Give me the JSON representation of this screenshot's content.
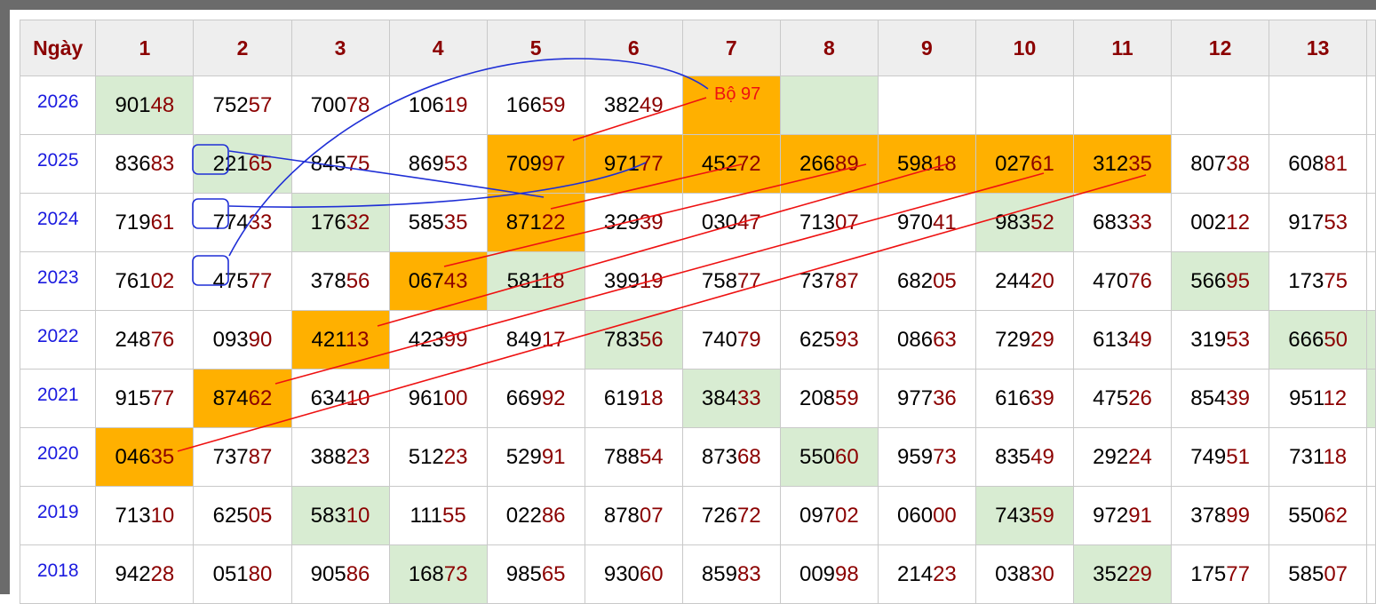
{
  "headers": [
    "Ngày",
    "1",
    "2",
    "3",
    "4",
    "5",
    "6",
    "7",
    "8",
    "9",
    "10",
    "11",
    "12",
    "13"
  ],
  "annotation": "Bộ 97",
  "colors": {
    "year_text": "#1a1adf",
    "header_text": "#8b0000",
    "digit_highlight": "#8b0000",
    "green_cell": "#d8ecd2",
    "orange_cell": "#ffb000",
    "line_red": "#ee1111",
    "line_blue": "#1f2fd6"
  },
  "rows": [
    {
      "year": "2026",
      "cells": [
        {
          "v": "90148",
          "bg": "green"
        },
        {
          "v": "75257"
        },
        {
          "v": "70078"
        },
        {
          "v": "10619"
        },
        {
          "v": "16659"
        },
        {
          "v": "38249"
        },
        {
          "v": "",
          "bg": "orange"
        },
        {
          "v": "",
          "bg": "green"
        },
        {
          "v": ""
        },
        {
          "v": ""
        },
        {
          "v": ""
        },
        {
          "v": ""
        },
        {
          "v": ""
        }
      ]
    },
    {
      "year": "2025",
      "cells": [
        {
          "v": "83683"
        },
        {
          "v": "22165",
          "bg": "green"
        },
        {
          "v": "84575"
        },
        {
          "v": "86953"
        },
        {
          "v": "70997",
          "bg": "orange"
        },
        {
          "v": "97177",
          "bg": "orange"
        },
        {
          "v": "45272",
          "bg": "orange"
        },
        {
          "v": "26689",
          "bg": "orange"
        },
        {
          "v": "59818",
          "bg": "orange"
        },
        {
          "v": "02761",
          "bg": "orange"
        },
        {
          "v": "31235",
          "bg": "orange"
        },
        {
          "v": "80738"
        },
        {
          "v": "60881"
        }
      ]
    },
    {
      "year": "2024",
      "cells": [
        {
          "v": "71961"
        },
        {
          "v": "77433"
        },
        {
          "v": "17632",
          "bg": "green"
        },
        {
          "v": "58535"
        },
        {
          "v": "87122",
          "bg": "orange"
        },
        {
          "v": "32939"
        },
        {
          "v": "03047"
        },
        {
          "v": "71307"
        },
        {
          "v": "97041"
        },
        {
          "v": "98352",
          "bg": "green"
        },
        {
          "v": "68333"
        },
        {
          "v": "00212"
        },
        {
          "v": "91753"
        }
      ]
    },
    {
      "year": "2023",
      "cells": [
        {
          "v": "76102"
        },
        {
          "v": "47577"
        },
        {
          "v": "37856"
        },
        {
          "v": "06743",
          "bg": "orange"
        },
        {
          "v": "58118",
          "bg": "green"
        },
        {
          "v": "39919"
        },
        {
          "v": "75877"
        },
        {
          "v": "73787"
        },
        {
          "v": "68205"
        },
        {
          "v": "24420"
        },
        {
          "v": "47076"
        },
        {
          "v": "56695",
          "bg": "green"
        },
        {
          "v": "17375"
        }
      ]
    },
    {
      "year": "2022",
      "cells": [
        {
          "v": "24876"
        },
        {
          "v": "09390"
        },
        {
          "v": "42113",
          "bg": "orange"
        },
        {
          "v": "42399"
        },
        {
          "v": "84917"
        },
        {
          "v": "78356",
          "bg": "green"
        },
        {
          "v": "74079"
        },
        {
          "v": "62593"
        },
        {
          "v": "08663"
        },
        {
          "v": "72929"
        },
        {
          "v": "61349"
        },
        {
          "v": "31953"
        },
        {
          "v": "66650",
          "bg": "green"
        }
      ]
    },
    {
      "year": "2021",
      "cells": [
        {
          "v": "91577"
        },
        {
          "v": "87462",
          "bg": "orange"
        },
        {
          "v": "63410"
        },
        {
          "v": "96100"
        },
        {
          "v": "66992"
        },
        {
          "v": "61918"
        },
        {
          "v": "38433",
          "bg": "green"
        },
        {
          "v": "20859"
        },
        {
          "v": "97736"
        },
        {
          "v": "61639"
        },
        {
          "v": "47526"
        },
        {
          "v": "85439"
        },
        {
          "v": "95112"
        }
      ]
    },
    {
      "year": "2020",
      "cells": [
        {
          "v": "04635",
          "bg": "orange"
        },
        {
          "v": "73787"
        },
        {
          "v": "38823"
        },
        {
          "v": "51223"
        },
        {
          "v": "52991"
        },
        {
          "v": "78854"
        },
        {
          "v": "87368"
        },
        {
          "v": "55060",
          "bg": "green"
        },
        {
          "v": "95973"
        },
        {
          "v": "83549"
        },
        {
          "v": "29224"
        },
        {
          "v": "74951"
        },
        {
          "v": "73118"
        }
      ]
    },
    {
      "year": "2019",
      "cells": [
        {
          "v": "71310"
        },
        {
          "v": "62505"
        },
        {
          "v": "58310",
          "bg": "green"
        },
        {
          "v": "11155"
        },
        {
          "v": "02286"
        },
        {
          "v": "87807"
        },
        {
          "v": "72672"
        },
        {
          "v": "09702"
        },
        {
          "v": "06000"
        },
        {
          "v": "74359",
          "bg": "green"
        },
        {
          "v": "97291"
        },
        {
          "v": "37899"
        },
        {
          "v": "55062"
        }
      ]
    },
    {
      "year": "2018",
      "cells": [
        {
          "v": "94228"
        },
        {
          "v": "05180"
        },
        {
          "v": "90586"
        },
        {
          "v": "16873",
          "bg": "green"
        },
        {
          "v": "98565"
        },
        {
          "v": "93060"
        },
        {
          "v": "85983"
        },
        {
          "v": "00998"
        },
        {
          "v": "21423"
        },
        {
          "v": "03830"
        },
        {
          "v": "35229",
          "bg": "green"
        },
        {
          "v": "17577"
        },
        {
          "v": "58507"
        }
      ]
    }
  ]
}
